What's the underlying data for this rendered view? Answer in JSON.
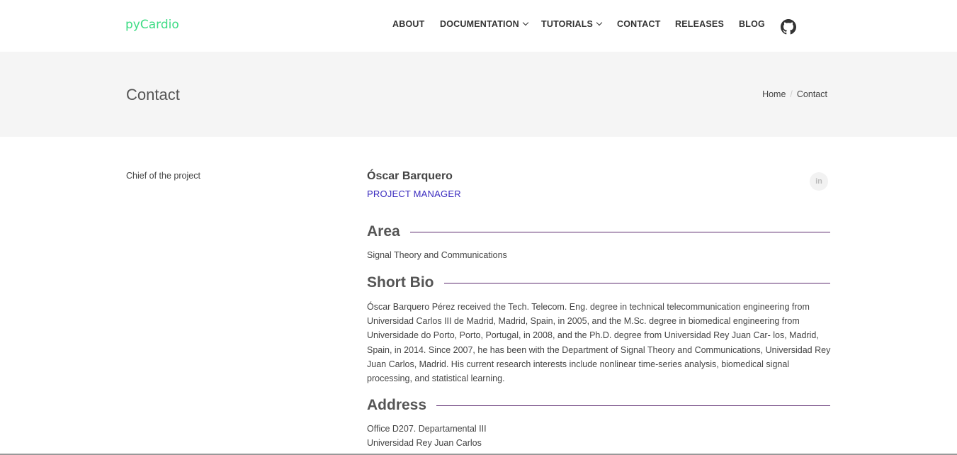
{
  "header": {
    "logo": "pyCardio",
    "nav": [
      {
        "label": "ABOUT",
        "dropdown": false
      },
      {
        "label": "DOCUMENTATION",
        "dropdown": true
      },
      {
        "label": "TUTORIALS",
        "dropdown": true
      },
      {
        "label": "CONTACT",
        "dropdown": false
      },
      {
        "label": "RELEASES",
        "dropdown": false
      },
      {
        "label": "BLOG",
        "dropdown": false
      }
    ],
    "github_icon": "github-icon"
  },
  "page": {
    "title": "Contact",
    "breadcrumb": {
      "home": "Home",
      "separator": "/",
      "current": "Contact"
    }
  },
  "member": {
    "group_label": "Chief of the project",
    "name": "Óscar Barquero",
    "role": "PROJECT MANAGER",
    "linkedin_label": "in",
    "area": {
      "heading": "Area",
      "text": "Signal Theory and Communications"
    },
    "bio": {
      "heading": "Short Bio",
      "text": "Óscar Barquero Pérez received the Tech. Telecom. Eng. degree in technical telecommunication engineering from Universidad Carlos III de Madrid, Madrid, Spain, in 2005, and the M.Sc. degree in biomedical engineering from Universidade do Porto, Porto, Portugal, in 2008, and the Ph.D. degree from Universidad Rey Juan Car- los, Madrid, Spain, in 2014. Since 2007, he has been with the Department of Signal Theory and Communications, Universidad Rey Juan Carlos, Madrid. His current research interests include nonlinear time-series analysis, biomedical signal processing, and statistical learning."
    },
    "address": {
      "heading": "Address",
      "line1": "Office D207. Departamental III",
      "line2": "Universidad Rey Juan Carlos"
    }
  },
  "colors": {
    "logo": "#3ddc84",
    "role": "#3a2bbf",
    "section_rule": "#5b2a6e",
    "title_band": "#f5f5f5"
  }
}
